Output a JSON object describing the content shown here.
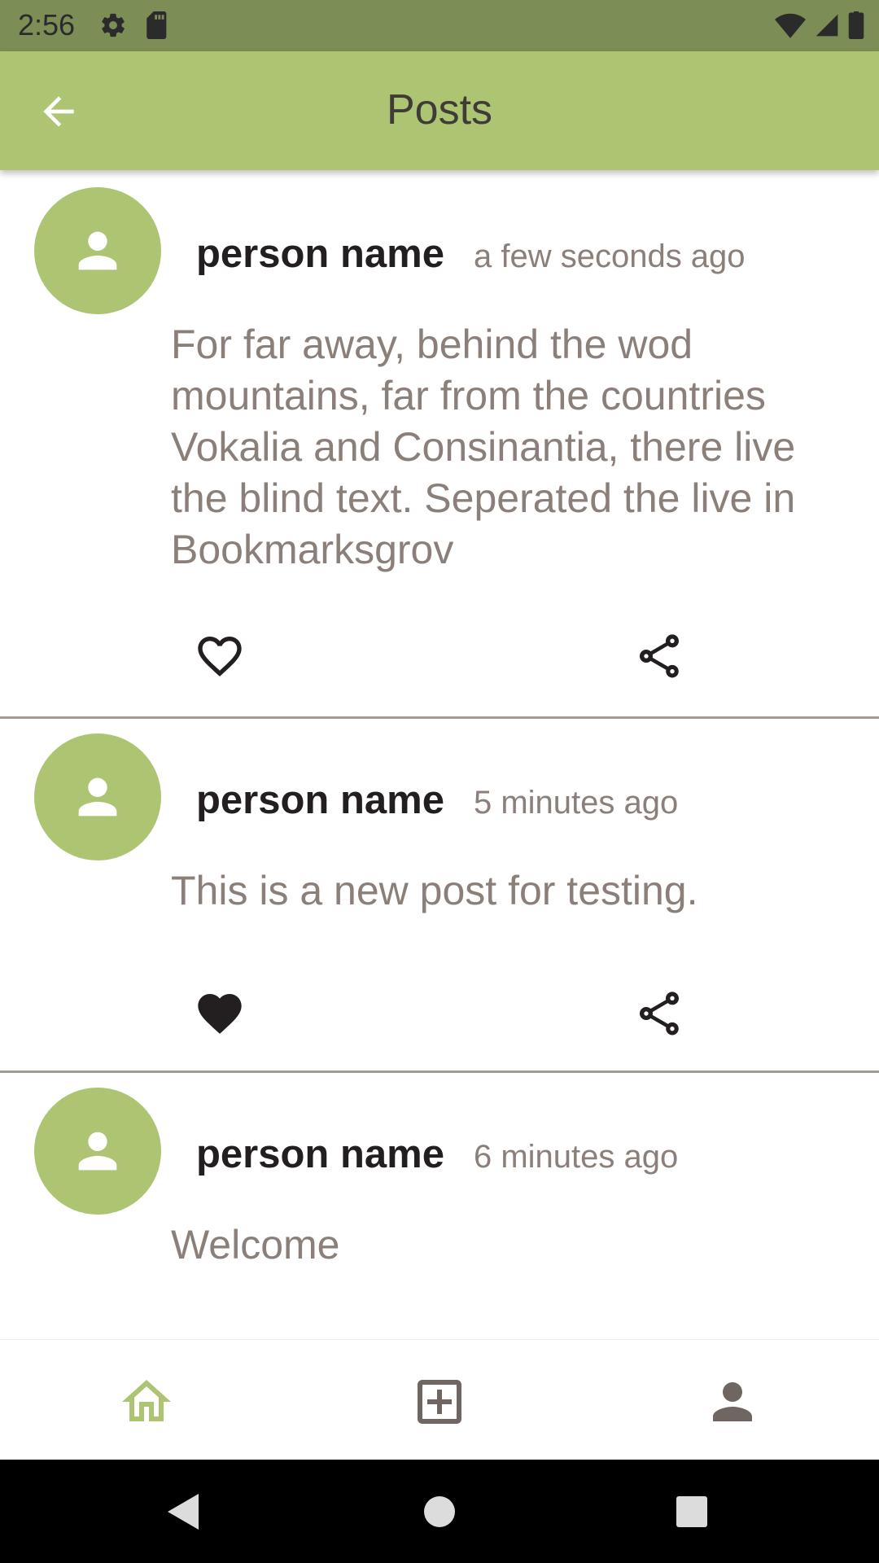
{
  "status_bar": {
    "time": "2:56"
  },
  "app_bar": {
    "title": "Posts"
  },
  "posts": [
    {
      "author": "person name",
      "time": "a few seconds ago",
      "body": "For far away, behind the wod mountains, far from the countries Vokalia and Consinantia, there live the blind text. Seperated the live in Bookmarksgrov",
      "liked": false
    },
    {
      "author": "person name",
      "time": "5 minutes ago",
      "body": "This is a new post for testing.",
      "liked": true
    },
    {
      "author": "person name",
      "time": "6 minutes ago",
      "body": "Welcome",
      "liked": false
    }
  ],
  "icons": {
    "back": "arrow-back-icon",
    "avatar": "person-icon",
    "like": "heart-icon",
    "share": "share-icon",
    "home": "home-icon",
    "add": "add-box-icon",
    "profile": "person-icon"
  },
  "colors": {
    "accent": "#adc472",
    "status_bar": "#7c8e55",
    "text_secondary": "#8b7f79",
    "text_primary": "#231f20"
  }
}
